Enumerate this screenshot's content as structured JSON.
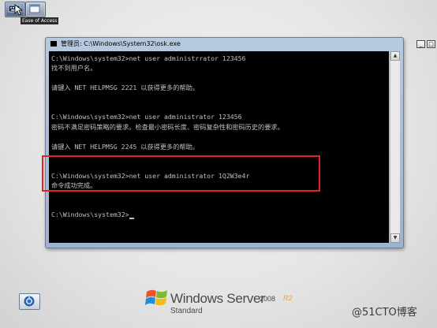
{
  "top_controls": {
    "caption": "Ease of Access",
    "button1_icon": "keyboard-icon",
    "button2_icon": "window-icon"
  },
  "window": {
    "title": "管理员: C:\\Windows\\System32\\osk.exe",
    "min_glyph": "_",
    "max_glyph": "□",
    "close_glyph": "X"
  },
  "console": {
    "lines": [
      "C:\\Windows\\system32>net user administrrator 123456",
      "找不到用户名。",
      "",
      "请键入 NET HELPMSG 2221 以获得更多的帮助。",
      "",
      "",
      "C:\\Windows\\system32>net user administrator 123456",
      "密码不满足密码策略的要求。检查最小密码长度、密码复杂性和密码历史的要求。",
      "",
      "请键入 NET HELPMSG 2245 以获得更多的帮助。",
      "",
      "",
      "C:\\Windows\\system32>net user administrator 1Q2W3e4r",
      "命令成功完成。",
      "",
      "",
      "C:\\Windows\\system32>"
    ]
  },
  "highlight_color": "#e0242a",
  "branding": {
    "name": "Windows Server",
    "version": "2008",
    "release": "R2",
    "edition": "Standard"
  },
  "watermark": "@51CTO博客",
  "colors": {
    "console_bg": "#000000",
    "console_text": "#c0c0c0",
    "desktop_bg": "#e6e6e6"
  }
}
